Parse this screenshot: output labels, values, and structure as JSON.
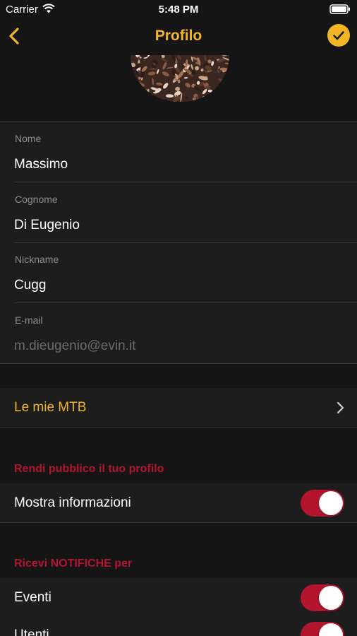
{
  "status_bar": {
    "carrier": "Carrier",
    "time": "5:48 PM"
  },
  "nav": {
    "title": "Profilo",
    "back_icon": "chevron-left-icon",
    "confirm_icon": "checkmark-icon"
  },
  "form": {
    "fields": [
      {
        "label": "Nome",
        "value": "Massimo"
      },
      {
        "label": "Cognome",
        "value": "Di Eugenio"
      },
      {
        "label": "Nickname",
        "value": "Cugg"
      },
      {
        "label": "E-mail",
        "value": "m.dieugenio@evin.it"
      }
    ]
  },
  "mtb": {
    "label": "Le mie MTB"
  },
  "privacy": {
    "title": "Rendi pubblico il tuo profilo",
    "toggles": [
      {
        "label": "Mostra informazioni",
        "on": true
      }
    ]
  },
  "notifications": {
    "title": "Ricevi NOTIFICHE per",
    "toggles": [
      {
        "label": "Eventi",
        "on": true
      },
      {
        "label": "Utenti",
        "on": true
      }
    ]
  },
  "colors": {
    "accent": "#f2b526",
    "danger": "#b3152e",
    "background": "#151515",
    "row": "#1d1d1d"
  }
}
